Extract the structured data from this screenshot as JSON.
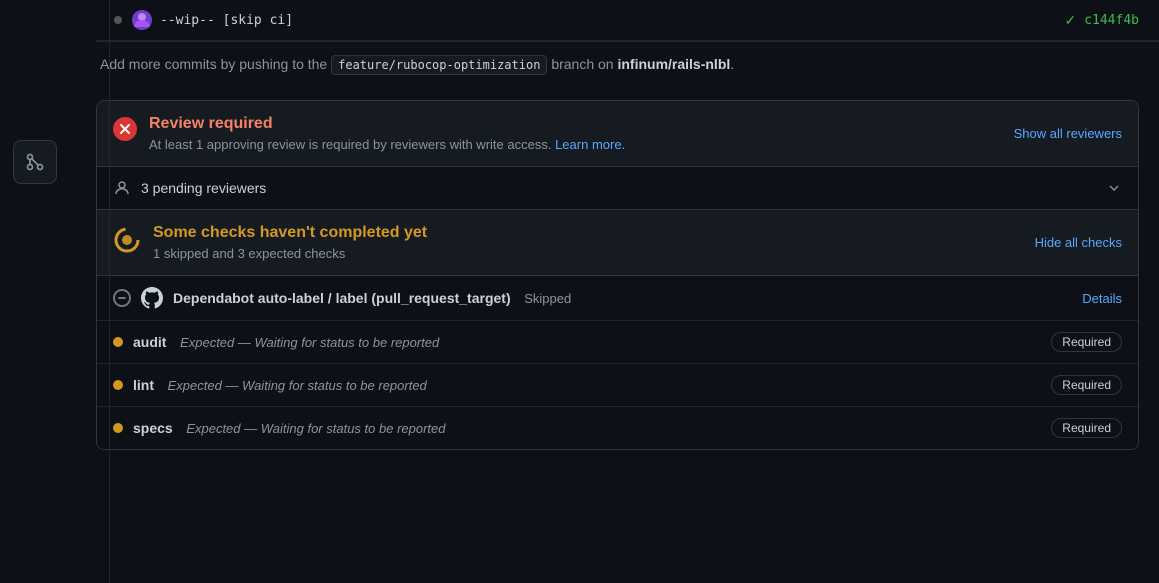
{
  "topbar": {
    "commit_message": "--wip-- [skip ci]",
    "commit_sha": "c144f4b",
    "sha_check": "✓"
  },
  "info": {
    "prefix": "Add more commits by pushing to the",
    "branch": "feature/rubocop-optimization",
    "middle": "branch on",
    "repo": "infinum/rails-nlbl",
    "suffix": "."
  },
  "review_required": {
    "title": "Review required",
    "description": "At least 1 approving review is required by reviewers with write access.",
    "learn_more": "Learn more.",
    "show_all_reviewers": "Show all reviewers"
  },
  "pending_reviewers": {
    "label": "3 pending reviewers"
  },
  "some_checks": {
    "title": "Some checks haven't completed yet",
    "description": "1 skipped and 3 expected checks",
    "hide_all": "Hide all checks"
  },
  "check_items": [
    {
      "type": "skipped",
      "name": "Dependabot auto-label / label (pull_request_target)",
      "status": "Skipped",
      "action": "Details"
    },
    {
      "type": "pending",
      "name": "audit",
      "expected": "Expected — Waiting for status to be reported",
      "badge": "Required"
    },
    {
      "type": "pending",
      "name": "lint",
      "expected": "Expected — Waiting for status to be reported",
      "badge": "Required"
    },
    {
      "type": "pending",
      "name": "specs",
      "expected": "Expected — Waiting for status to be reported",
      "badge": "Required"
    }
  ]
}
